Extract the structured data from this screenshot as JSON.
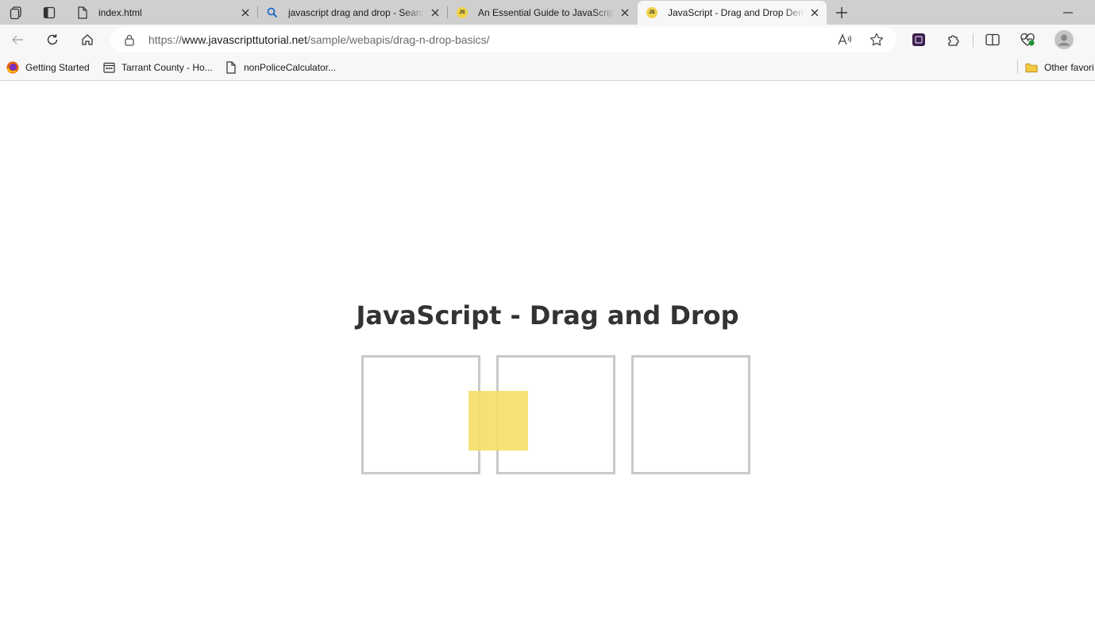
{
  "browser": {
    "tabs": [
      {
        "title": "index.html",
        "icon": "file-icon",
        "active": false
      },
      {
        "title": "javascript drag and drop - Search",
        "icon": "search-icon",
        "active": false
      },
      {
        "title": "An Essential Guide to JavaScript Drag and Drop",
        "icon": "js-badge-icon",
        "active": false
      },
      {
        "title": "JavaScript - Drag and Drop Demo",
        "icon": "js-badge-icon",
        "active": true
      }
    ],
    "js_badge_text": "JS",
    "url": {
      "scheme": "https://",
      "host": "www.javascripttutorial.net",
      "path": "/sample/webapis/drag-n-drop-basics/"
    },
    "bookmarks": [
      {
        "label": "Getting Started",
        "icon": "firefox-icon"
      },
      {
        "label": "Tarrant County - Ho...",
        "icon": "calendar-icon"
      },
      {
        "label": "nonPoliceCalculator...",
        "icon": "file-icon"
      }
    ],
    "other_favorites": "Other favori"
  },
  "page": {
    "heading": "JavaScript - Drag and Drop",
    "drop_boxes": 3,
    "item_color": "#f5de66",
    "box_border_color": "#c9c9c9"
  }
}
